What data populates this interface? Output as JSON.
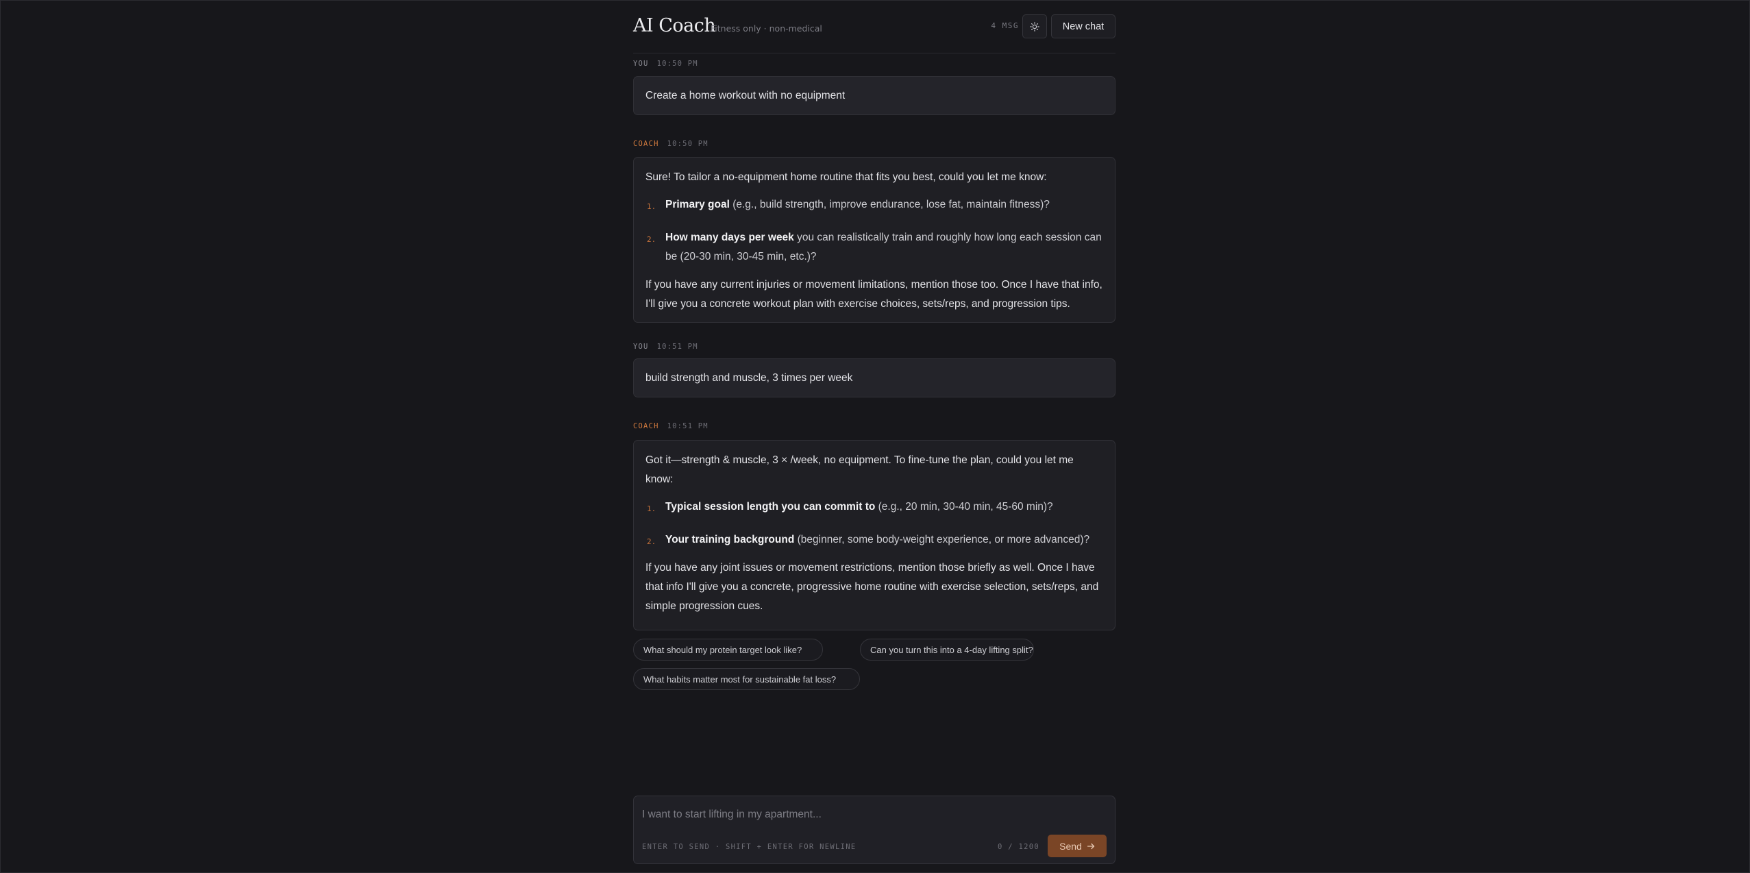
{
  "header": {
    "title": "AI Coach",
    "subtitle": "Fitness only · non-medical",
    "message_count": "4 MSG",
    "new_chat_label": "New chat",
    "theme_icon": "sun-icon"
  },
  "messages": [
    {
      "role": "YOU",
      "time": "10:50 PM",
      "text": "Create a home workout with no equipment"
    },
    {
      "role": "COACH",
      "time": "10:50 PM",
      "intro": "Sure! To tailor a no-equipment home routine that fits you best, could you let me know:",
      "items": [
        {
          "num": "1.",
          "bold": "Primary goal",
          "rest": " (e.g., build strength, improve endurance, lose fat, maintain fitness)?"
        },
        {
          "num": "2.",
          "bold": "How many days per week",
          "rest": " you can realistically train and roughly how long each session can be (20-30 min, 30-45 min, etc.)?"
        }
      ],
      "outro": "If you have any current injuries or movement limitations, mention those too. Once I have that info, I'll give you a concrete workout plan with exercise choices, sets/reps, and progression tips."
    },
    {
      "role": "YOU",
      "time": "10:51 PM",
      "text": "build strength and muscle, 3 times per week"
    },
    {
      "role": "COACH",
      "time": "10:51 PM",
      "intro": "Got it—strength & muscle, 3 × /week, no equipment. To fine-tune the plan, could you let me know:",
      "items": [
        {
          "num": "1.",
          "bold": "Typical session length you can commit to",
          "rest": " (e.g., 20 min, 30-40 min, 45-60 min)?"
        },
        {
          "num": "2.",
          "bold": "Your training background",
          "rest": " (beginner, some body-weight experience, or more advanced)?"
        }
      ],
      "outro": "If you have any joint issues or movement restrictions, mention those briefly as well. Once I have that info I'll give you a concrete, progressive home routine with exercise selection, sets/reps, and simple progression cues."
    }
  ],
  "suggestions": [
    "What should my protein target look like?",
    "Can you turn this into a 4-day lifting split?",
    "What habits matter most for sustainable fat loss?"
  ],
  "composer": {
    "placeholder": "I want to start lifting in my apartment...",
    "value": "",
    "hint": "ENTER TO SEND · SHIFT + ENTER FOR NEWLINE",
    "counter": "0 / 1200",
    "send_label": "Send",
    "send_icon": "arrow-right-icon"
  },
  "colors": {
    "background": "#17171b",
    "accent": "#d07a3e",
    "send_button": "#7a4526"
  }
}
